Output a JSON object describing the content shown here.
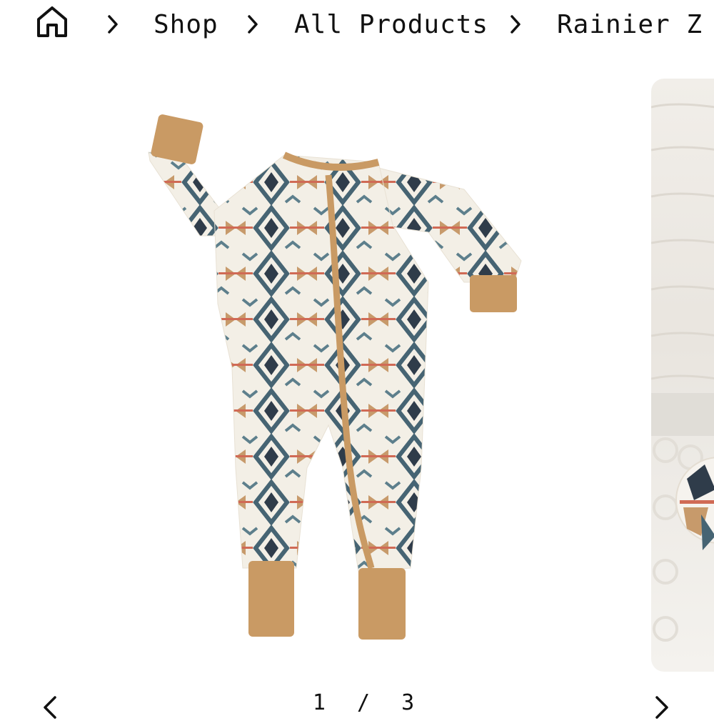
{
  "breadcrumb": {
    "home_icon": "home-icon",
    "separator_icon": "chevron-right-icon",
    "items": [
      {
        "label": "Shop"
      },
      {
        "label": "All Products"
      },
      {
        "label": "Rainier Z"
      }
    ]
  },
  "gallery": {
    "current_slide": {
      "alt": "zip romper with aztec pattern",
      "pattern_colors": [
        "#f3efe6",
        "#466473",
        "#2f3c4a",
        "#c79a6b",
        "#d06a55"
      ],
      "trim_color": "#c99a64"
    },
    "pager": {
      "current": "1",
      "separator": "/",
      "total": "3",
      "prev_icon": "chevron-left-icon",
      "next_icon": "chevron-right-icon"
    }
  }
}
